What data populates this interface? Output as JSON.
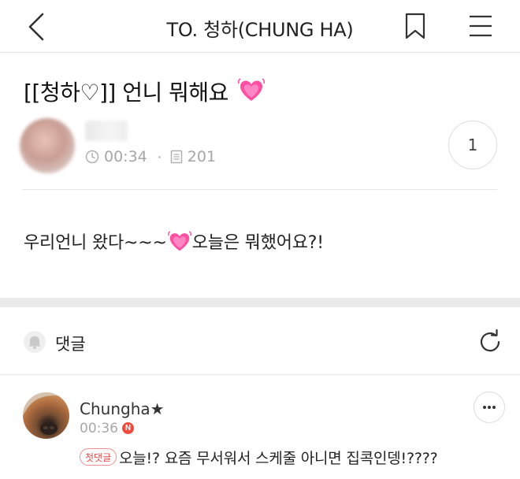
{
  "header": {
    "title": "TO. 청하(CHUNG HA)",
    "back_icon": "chevron-left-icon",
    "bookmark_icon": "bookmark-icon",
    "menu_icon": "hamburger-menu-icon"
  },
  "post": {
    "title": "[[청하♡]] 언니 뭐해요",
    "title_emoji": "sparkling-heart-emoji",
    "time": "00:34",
    "views": "201",
    "comment_count": "1",
    "body_part1": "우리언니 왔다~~~",
    "body_part2": "오늘은 뭐했어요?!"
  },
  "comments_section": {
    "label": "댓글",
    "bell_icon": "bell-icon",
    "refresh_icon": "refresh-icon"
  },
  "comment": {
    "author": "Chungha★",
    "time": "00:36",
    "new_badge": "N",
    "first_badge": "첫댓글",
    "text": "오늘!? 요즘 무서워서 스케줄 아니면 집콕인뎅!????"
  },
  "colors": {
    "heart": "#ff4fa3",
    "new_badge": "#f04a3c",
    "first_badge_border": "#f08f8f",
    "meta_gray": "#a6a6a6",
    "section_gap": "#ebebeb"
  }
}
